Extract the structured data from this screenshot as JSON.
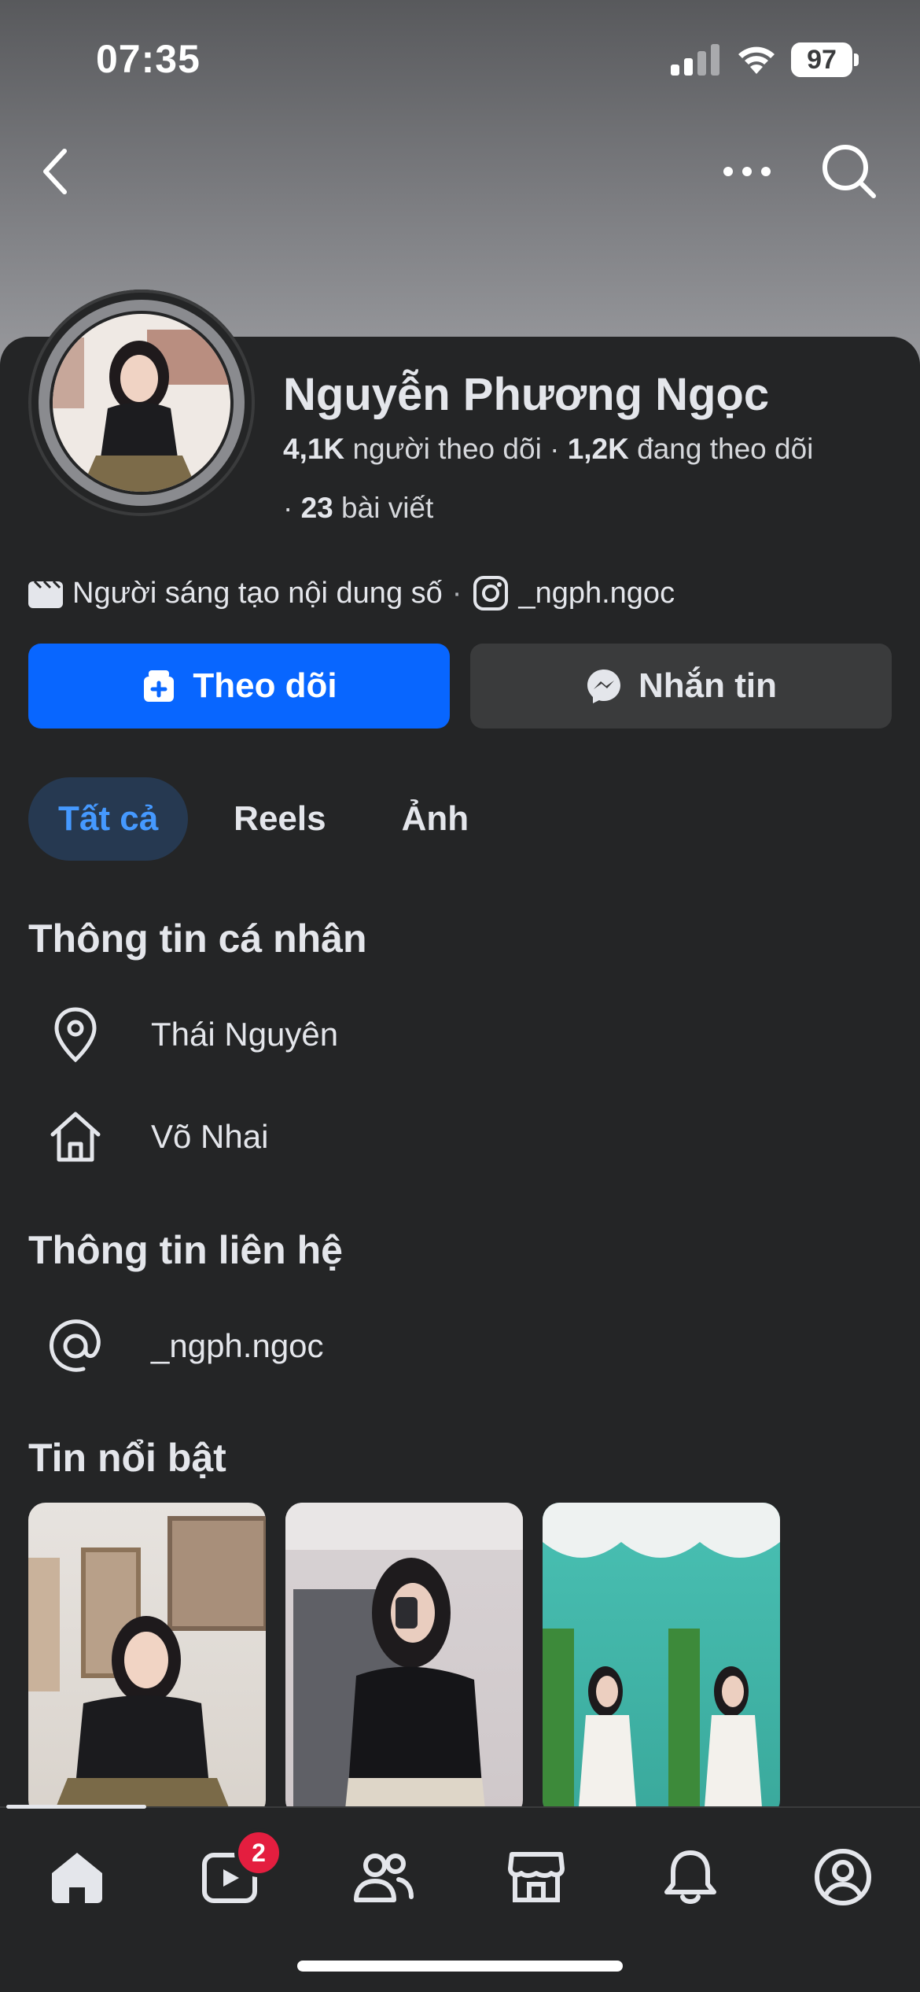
{
  "status_bar": {
    "time": "07:35",
    "battery": "97"
  },
  "profile": {
    "name": "Nguyễn Phương Ngọc",
    "followers_count": "4,1K",
    "followers_label": "người theo dõi",
    "following_count": "1,2K",
    "following_label": "đang theo dõi",
    "posts_count": "23",
    "posts_label": "bài viết",
    "category": "Người sáng tạo nội dung số",
    "instagram": "_ngph.ngoc"
  },
  "actions": {
    "follow_label": "Theo dõi",
    "message_label": "Nhắn tin"
  },
  "tabs": [
    {
      "label": "Tất cả",
      "active": true
    },
    {
      "label": "Reels",
      "active": false
    },
    {
      "label": "Ảnh",
      "active": false
    }
  ],
  "personal_info": {
    "title": "Thông tin cá nhân",
    "items": [
      {
        "icon": "location-pin-icon",
        "text": "Thái Nguyên"
      },
      {
        "icon": "home-icon",
        "text": "Võ Nhai"
      }
    ]
  },
  "contact_info": {
    "title": "Thông tin liên hệ",
    "items": [
      {
        "icon": "at-sign-icon",
        "text": "_ngph.ngoc"
      }
    ]
  },
  "highlights": {
    "title": "Tin nổi bật"
  },
  "bottom_nav": {
    "video_badge": "2"
  },
  "colors": {
    "background": "#242526",
    "primary_button": "#0866ff",
    "secondary_button": "#3a3b3c",
    "active_tab_bg": "#263951",
    "active_tab_text": "#4599ff",
    "badge": "#e41e3f"
  }
}
